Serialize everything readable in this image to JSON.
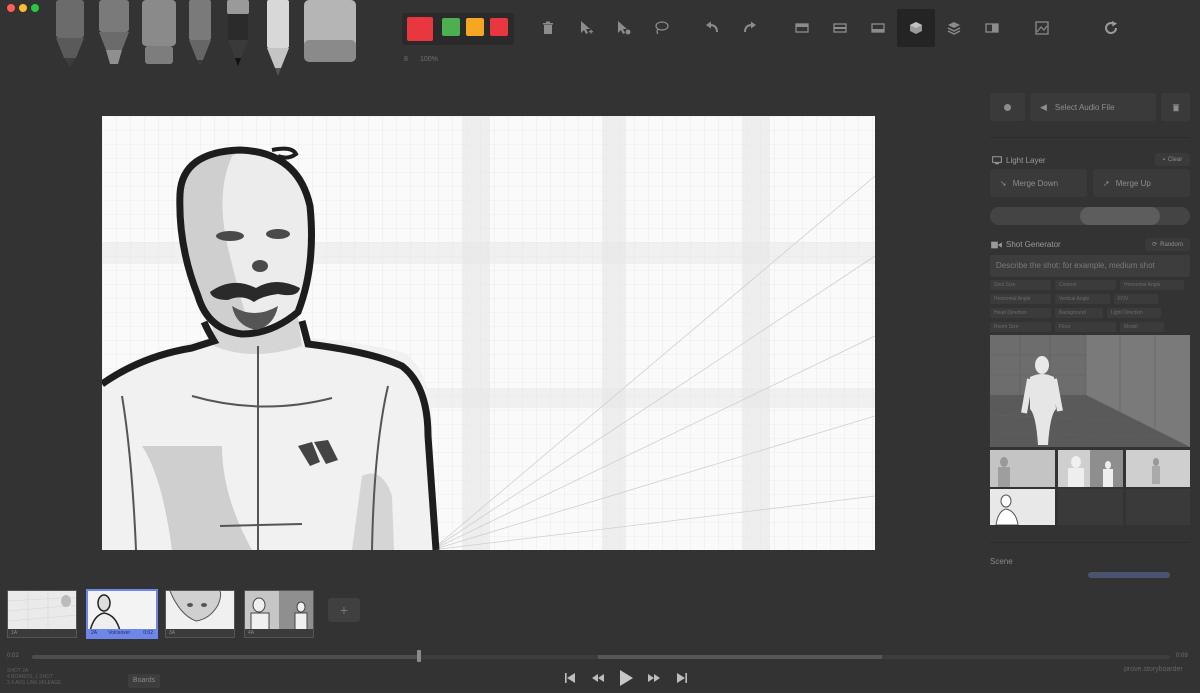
{
  "toolbar": {
    "size_label": "8",
    "opacity_label": "100%",
    "brush_colors": [
      "#e8373f",
      "#4caf50",
      "#f5a623",
      "#e8373f"
    ],
    "icons": [
      "trash-icon",
      "pointer-add-icon",
      "pointer-remove-icon",
      "lasso-icon",
      "undo-icon",
      "redo-icon",
      "layer-a-icon",
      "layer-b-icon",
      "layer-c-icon",
      "cube-icon",
      "layers-icon",
      "layer-d-icon",
      "image-icon",
      "refresh-icon"
    ]
  },
  "audio": {
    "select_label": "Select Audio File"
  },
  "light_layer": {
    "title": "Light Layer",
    "clear_label": "Clear",
    "merge_down": "Merge Down",
    "merge_up": "Merge Up"
  },
  "shot_generator": {
    "title": "Shot Generator",
    "random_label": "Random",
    "placeholder": "Describe the shot: for example, medium shot",
    "tags": [
      "Shot Size",
      "Content",
      "Horizontal Angle",
      "Horizontal Angle",
      "Vertical Angle",
      "FOV",
      "Head Direction",
      "Background",
      "Light Direction",
      "Room Size",
      "Floor",
      "Model"
    ]
  },
  "scene": {
    "label": "Scene"
  },
  "boards": [
    {
      "label": "1A",
      "time": "0:02"
    },
    {
      "label": "2A",
      "note": "Voiceover",
      "time": "0:02"
    },
    {
      "label": "3A",
      "time": "0:02"
    },
    {
      "label": "4A",
      "time": "0:02"
    }
  ],
  "timeline": {
    "current": "0:02",
    "total": "0:09",
    "progress": 0.34
  },
  "footer": {
    "info_lines": [
      "SHOT 2A",
      "4 BOARDS, 1 SHOT",
      "2.4 AVG LINE MILEAGE"
    ],
    "boards_button": "Boards",
    "brand": "prove.storyboarder"
  },
  "colors": {
    "bg": "#333333",
    "accent": "#6e86e8",
    "canvas": "#fafafa"
  }
}
